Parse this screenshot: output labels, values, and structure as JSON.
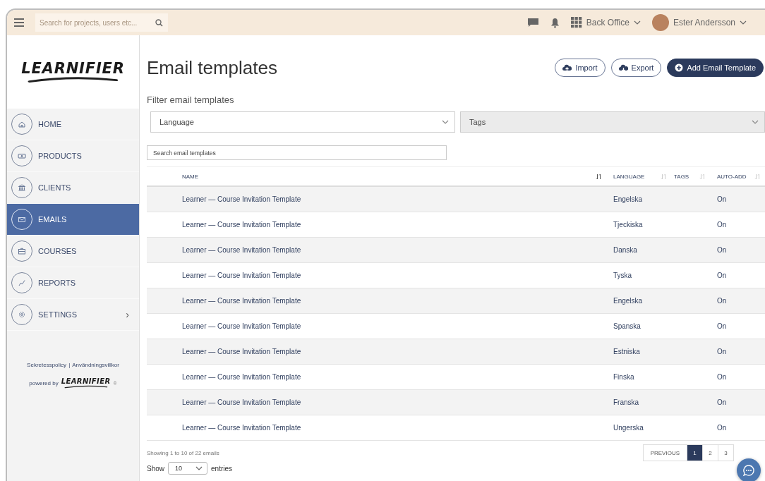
{
  "topbar": {
    "search": {
      "placeholder": "Search for projects, users etc..."
    },
    "workspace": "Back Office",
    "user": "Ester Andersson"
  },
  "sidebar": {
    "logo": "LEARNIFIER",
    "items": [
      {
        "label": "HOME",
        "selected": false,
        "has_submenu": false
      },
      {
        "label": "PRODUCTS",
        "selected": false,
        "has_submenu": false
      },
      {
        "label": "CLIENTS",
        "selected": false,
        "has_submenu": false
      },
      {
        "label": "EMAILS",
        "selected": true,
        "has_submenu": false
      },
      {
        "label": "COURSES",
        "selected": false,
        "has_submenu": false
      },
      {
        "label": "REPORTS",
        "selected": false,
        "has_submenu": false
      },
      {
        "label": "SETTINGS",
        "selected": false,
        "has_submenu": true,
        "submenu_mark": "›"
      }
    ],
    "footer_links": [
      "Sekretesspolicy",
      "Användningsvillkor"
    ],
    "footer_separator": "|",
    "powered_by": "powered by",
    "powered_logo": "LEARNIFIER",
    "registered_mark": "®"
  },
  "page": {
    "title": "Email templates",
    "actions": [
      {
        "label": "Import",
        "kind": "outline"
      },
      {
        "label": "Export",
        "kind": "outline"
      },
      {
        "label": "Add Email Template",
        "kind": "primary"
      }
    ],
    "filter_label": "Filter email templates",
    "filters": [
      {
        "placeholder": "Language",
        "disabled": false
      },
      {
        "placeholder": "Tags",
        "disabled": true
      }
    ],
    "search": {
      "placeholder": "Search email templates"
    },
    "table": {
      "columns": [
        {
          "label": "NAME",
          "sorted": true
        },
        {
          "label": "LANGUAGE",
          "sorted": false
        },
        {
          "label": "TAGS",
          "sorted": false
        },
        {
          "label": "AUTO-ADD",
          "sorted": false
        }
      ],
      "rows": [
        [
          "Learner — Course Invitation Template",
          "Engelska",
          "",
          "On"
        ],
        [
          "Learner — Course Invitation Template",
          "Tjeckiska",
          "",
          "On"
        ],
        [
          "Learner — Course Invitation Template",
          "Danska",
          "",
          "On"
        ],
        [
          "Learner — Course Invitation Template",
          "Tyska",
          "",
          "On"
        ],
        [
          "Learner — Course Invitation Template",
          "Engelska",
          "",
          "On"
        ],
        [
          "Learner — Course Invitation Template",
          "Spanska",
          "",
          "On"
        ],
        [
          "Learner — Course Invitation Template",
          "Estniska",
          "",
          "On"
        ],
        [
          "Learner — Course Invitation Template",
          "Finska",
          "",
          "On"
        ],
        [
          "Learner — Course Invitation Template",
          "Franska",
          "",
          "On"
        ],
        [
          "Learner — Course Invitation Template",
          "Ungerska",
          "",
          "On"
        ]
      ]
    },
    "info": "Showing 1 to 10 of 22 emails",
    "pagination": {
      "previous": "PREVIOUS",
      "pages": [
        {
          "label": "1",
          "selected": true
        },
        {
          "label": "2",
          "selected": false
        },
        {
          "label": "3",
          "selected": false
        }
      ]
    },
    "length": {
      "prefix": "Show",
      "value": "10",
      "suffix": "entries"
    }
  }
}
